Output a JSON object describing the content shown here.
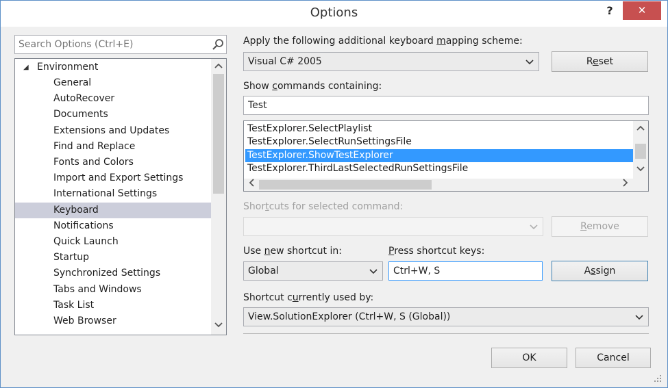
{
  "window": {
    "title": "Options",
    "help_label": "?",
    "close_label": "✕"
  },
  "search": {
    "placeholder": "Search Options (Ctrl+E)"
  },
  "tree": {
    "parent": "Environment",
    "items": [
      "General",
      "AutoRecover",
      "Documents",
      "Extensions and Updates",
      "Find and Replace",
      "Fonts and Colors",
      "Import and Export Settings",
      "International Settings",
      "Keyboard",
      "Notifications",
      "Quick Launch",
      "Startup",
      "Synchronized Settings",
      "Tabs and Windows",
      "Task List",
      "Web Browser"
    ],
    "selected": "Keyboard"
  },
  "mapping": {
    "label_pre": "Apply the following additional keyboard ",
    "label_ul": "m",
    "label_post": "apping scheme:",
    "value": "Visual C# 2005",
    "reset_pre": "R",
    "reset_ul": "e",
    "reset_post": "set"
  },
  "show_commands": {
    "label_pre": "Show ",
    "label_ul": "c",
    "label_post": "ommands containing:",
    "value": "Test"
  },
  "commands": {
    "items": [
      "TestExplorer.SelectPlaylist",
      "TestExplorer.SelectRunSettingsFile",
      "TestExplorer.ShowTestExplorer",
      "TestExplorer.ThirdLastSelectedRunSettingsFile"
    ],
    "selected_index": 2
  },
  "shortcuts": {
    "label_pre": "Shor",
    "label_ul": "t",
    "label_post": "cuts for selected command:",
    "value": "",
    "remove_pre": "",
    "remove_ul": "R",
    "remove_post": "emove"
  },
  "new_shortcut": {
    "use_label_pre": "Use ",
    "use_label_ul": "n",
    "use_label_post": "ew shortcut in:",
    "scope_value": "Global",
    "press_label_pre": "",
    "press_label_ul": "P",
    "press_label_post": "ress shortcut keys:",
    "keys_value": "Ctrl+W, S",
    "assign_pre": "A",
    "assign_ul": "s",
    "assign_post": "sign"
  },
  "used_by": {
    "label_pre": "Shortcut c",
    "label_ul": "u",
    "label_post": "rrently used by:",
    "value": "View.SolutionExplorer (Ctrl+W, S (Global))"
  },
  "footer": {
    "ok_label": "OK",
    "cancel_label": "Cancel"
  },
  "colors": {
    "selection": "#3399ff",
    "tree_selection": "#cccedb",
    "close_button": "#c75050"
  }
}
